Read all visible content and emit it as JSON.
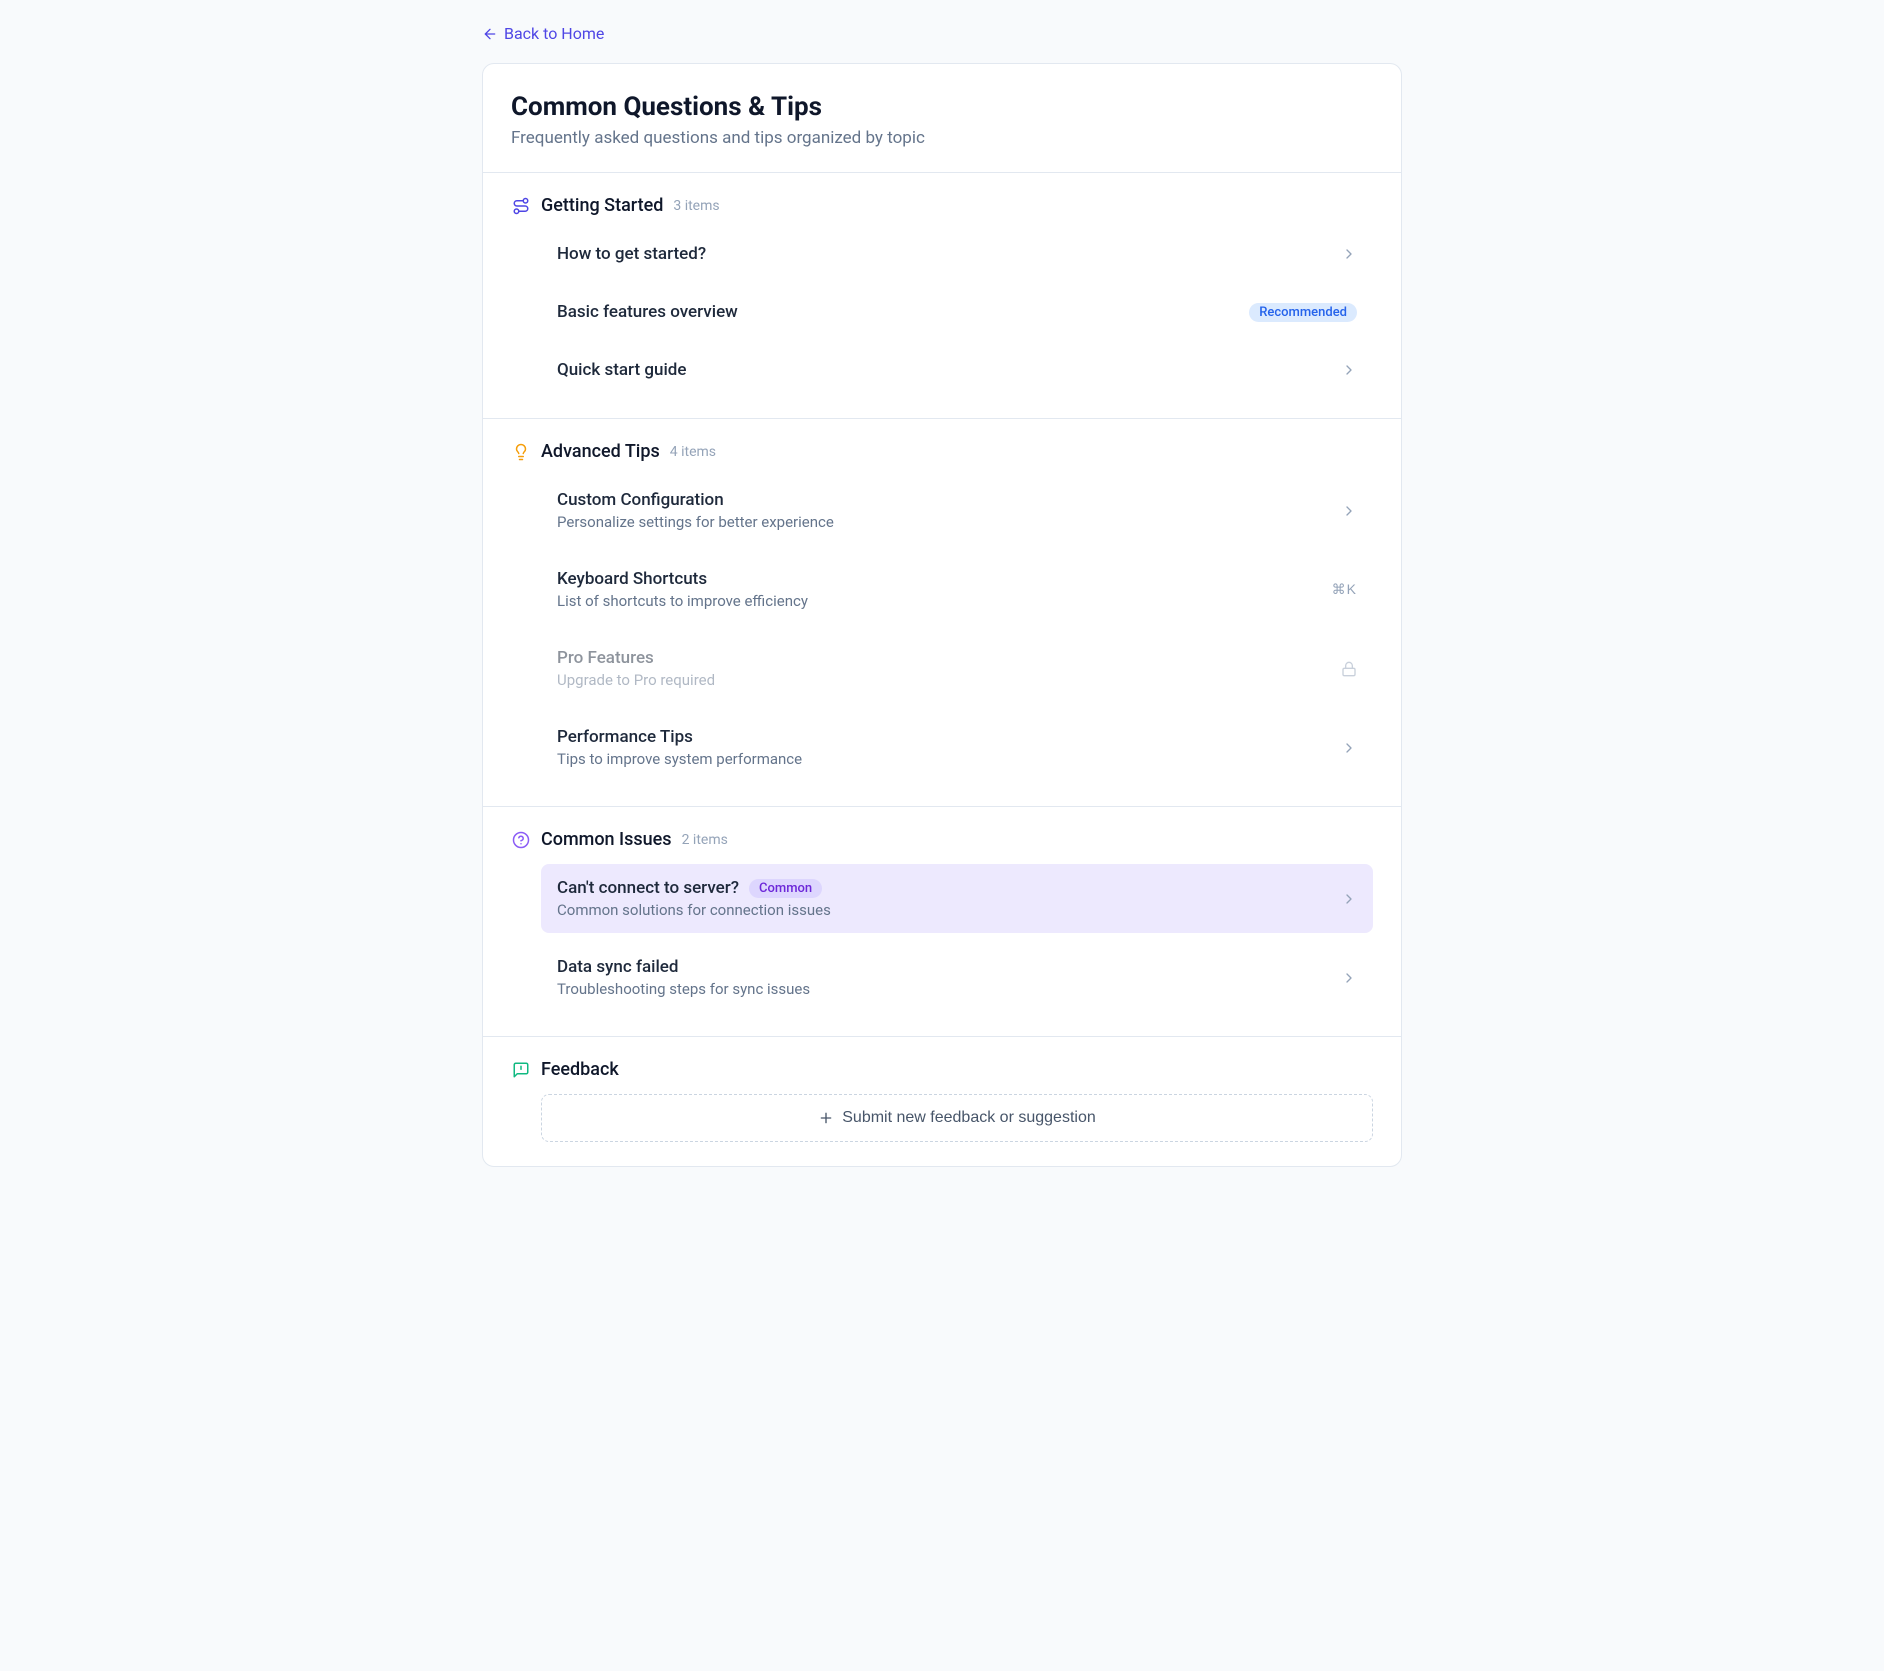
{
  "nav": {
    "back_label": "Back to Home"
  },
  "header": {
    "title": "Common Questions & Tips",
    "subtitle": "Frequently asked questions and tips organized by topic"
  },
  "sections": {
    "getting_started": {
      "title": "Getting Started",
      "count": "3 items",
      "items": [
        {
          "title": "How to get started?"
        },
        {
          "title": "Basic features overview",
          "badge": "Recommended"
        },
        {
          "title": "Quick start guide"
        }
      ]
    },
    "advanced_tips": {
      "title": "Advanced Tips",
      "count": "4 items",
      "items": [
        {
          "title": "Custom Configuration",
          "description": "Personalize settings for better experience"
        },
        {
          "title": "Keyboard Shortcuts",
          "description": "List of shortcuts to improve efficiency",
          "shortcut": "⌘K"
        },
        {
          "title": "Pro Features",
          "description": "Upgrade to Pro required",
          "locked": true
        },
        {
          "title": "Performance Tips",
          "description": "Tips to improve system performance"
        }
      ]
    },
    "common_issues": {
      "title": "Common Issues",
      "count": "2 items",
      "items": [
        {
          "title": "Can't connect to server?",
          "description": "Common solutions for connection issues",
          "badge": "Common",
          "highlighted": true
        },
        {
          "title": "Data sync failed",
          "description": "Troubleshooting steps for sync issues"
        }
      ]
    },
    "feedback": {
      "title": "Feedback",
      "button_label": "Submit new feedback or suggestion"
    }
  }
}
